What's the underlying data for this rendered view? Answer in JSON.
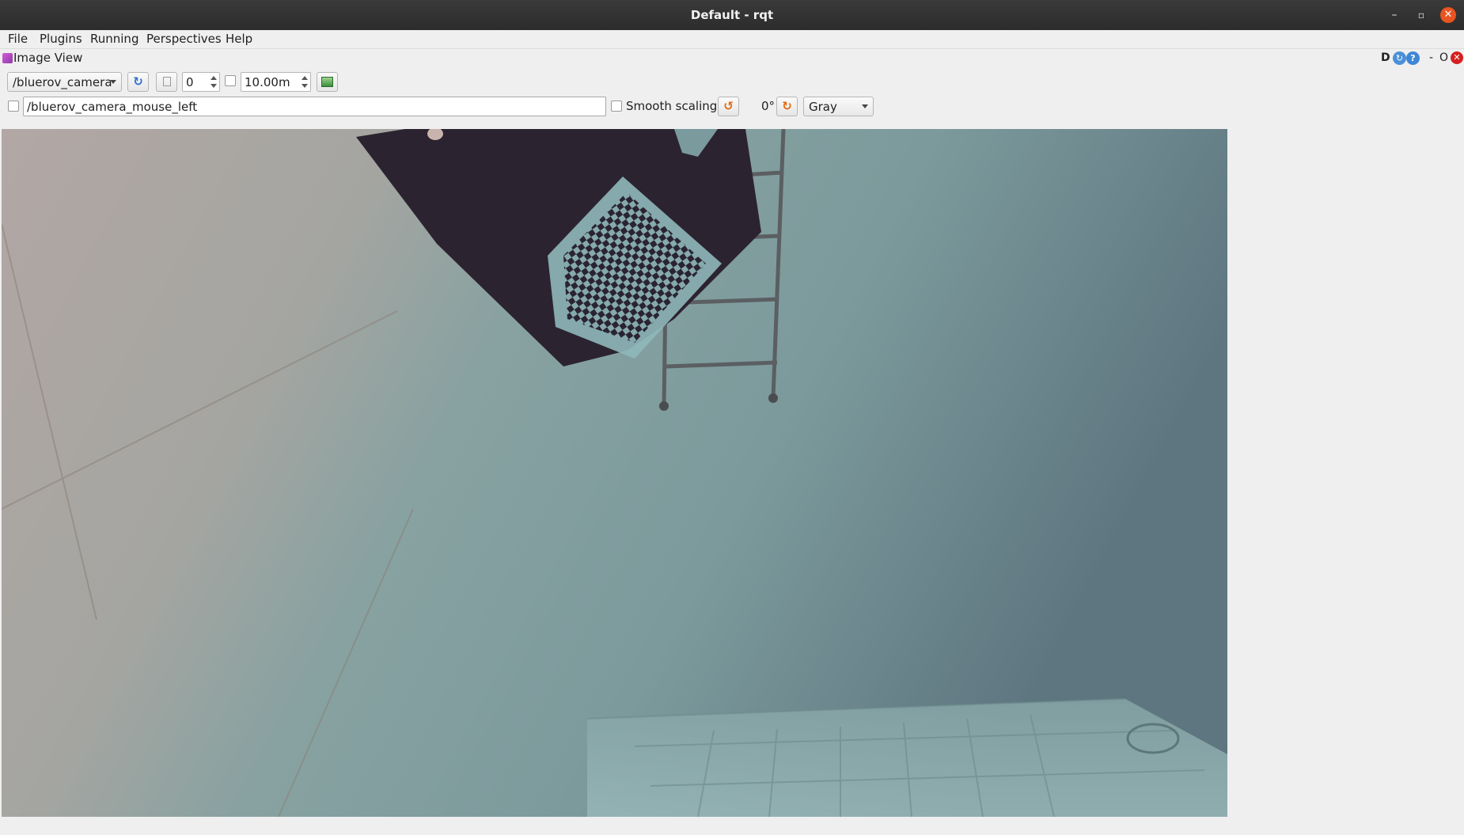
{
  "window": {
    "title": "Default - rqt",
    "min_icon": "minimize-icon",
    "max_icon": "maximize-icon",
    "close_icon": "close-icon"
  },
  "menu": [
    "File",
    "Plugins",
    "Running",
    "Perspectives",
    "Help"
  ],
  "plugin": {
    "title": "Image View",
    "header_buttons": {
      "d": "D",
      "dash": "-",
      "o": "O",
      "reload_icon": "reload-icon",
      "help_icon": "help-icon",
      "close_icon": "close-icon"
    }
  },
  "toolbar": {
    "topic": "/bluerov_camera",
    "refresh_icon": "refresh-icon",
    "zoom_icon": "zoom-icon",
    "spin_value": "0",
    "duration_value": "10.00m",
    "save_icon": "save-image-icon",
    "mouse_topic": "/bluerov_camera_mouse_left",
    "smooth_scaling_label": "Smooth scaling",
    "rotate_left_icon": "rotate-left-icon",
    "rotation_label": "0°",
    "rotate_right_icon": "rotate-right-icon",
    "color_scheme": "Gray"
  },
  "colors": {
    "close_button": "#e95420",
    "titlebar": "#2c2c2c",
    "background": "#efefef"
  }
}
